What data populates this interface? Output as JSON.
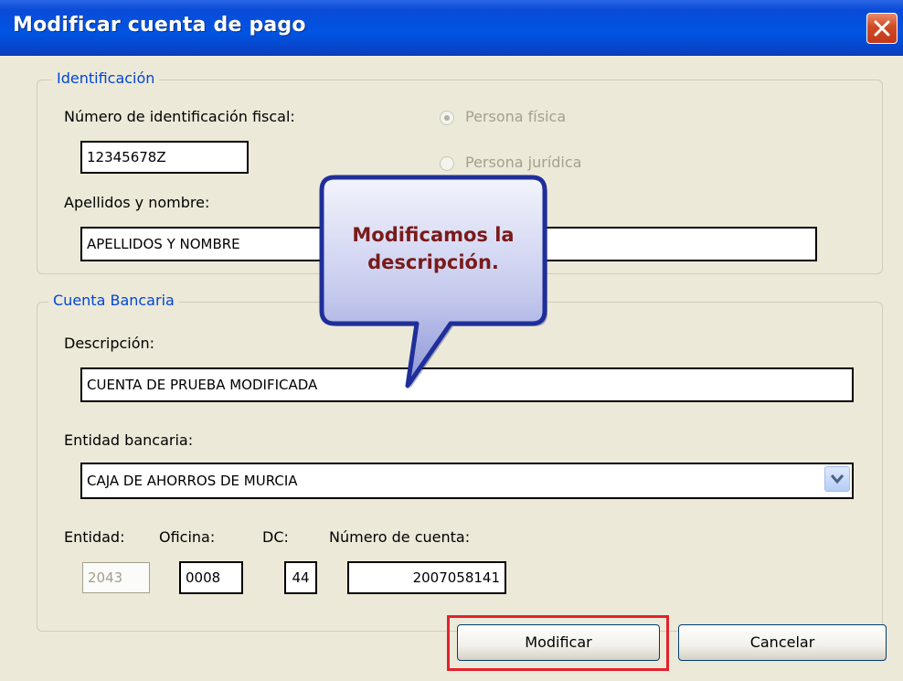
{
  "window": {
    "title": "Modificar cuenta de pago"
  },
  "identificacion": {
    "legend": "Identificación",
    "nif_label": "Número de identificación fiscal:",
    "nif_value": "12345678Z",
    "radio_fisica": "Persona física",
    "radio_juridica": "Persona jurídica",
    "nombre_label": "Apellidos y nombre:",
    "nombre_value": "APELLIDOS Y NOMBRE"
  },
  "callout": {
    "line1": "Modificamos la",
    "line2": "descripción."
  },
  "cuenta": {
    "legend": "Cuenta Bancaria",
    "descripcion_label": "Descripción:",
    "descripcion_value": "CUENTA DE PRUEBA MODIFICADA",
    "entidad_bancaria_label": "Entidad bancaria:",
    "entidad_bancaria_value": "CAJA DE AHORROS DE MURCIA",
    "entidad_label": "Entidad:",
    "oficina_label": "Oficina:",
    "dc_label": "DC:",
    "numero_label": "Número de cuenta:",
    "entidad_value": "2043",
    "oficina_value": "0008",
    "dc_value": "44",
    "numero_value": "2007058141"
  },
  "buttons": {
    "modificar": "Modificar",
    "cancelar": "Cancelar"
  },
  "colors": {
    "title_bar": "#0054e3",
    "legend_text": "#0046d5",
    "highlight": "#e3212b",
    "callout_text": "#7a1a1a"
  }
}
